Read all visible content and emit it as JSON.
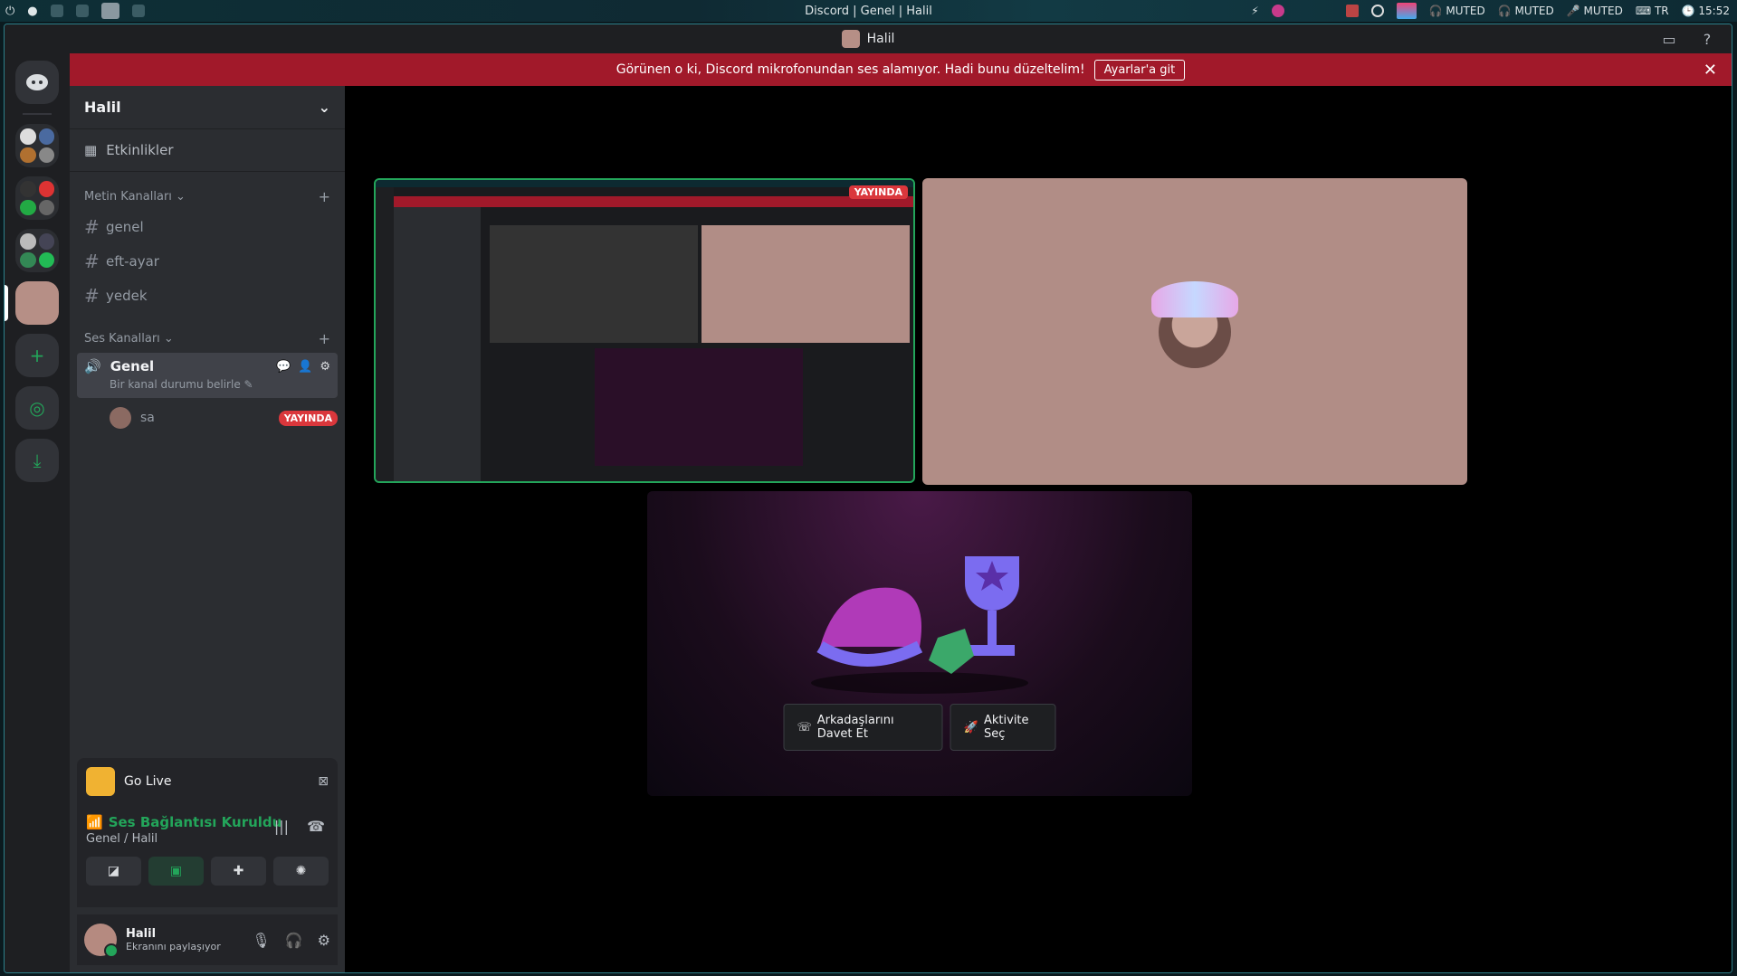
{
  "system_bar": {
    "title": "Discord | Genel | Halil",
    "tray": [
      "MUTED",
      "MUTED",
      "MUTED"
    ],
    "lang": "TR",
    "time": "15:52"
  },
  "window": {
    "title": "Halil"
  },
  "notice": {
    "text": "Görünen o ki, Discord mikrofonundan ses alamıyor. Hadi bunu düzeltelim!",
    "button": "Ayarlar'a git"
  },
  "sidebar": {
    "guild_name": "Halil",
    "events_label": "Etkinlikler",
    "text_category": "Metin Kanalları",
    "text_channels": [
      "genel",
      "eft-ayar",
      "yedek"
    ],
    "voice_category": "Ses Kanalları",
    "voice_channel": {
      "name": "Genel",
      "status_placeholder": "Bir kanal durumu belirle",
      "member_name": "sa",
      "member_badge": "YAYINDA"
    }
  },
  "bottom": {
    "golive_label": "Go Live",
    "voice_status": "Ses Bağlantısı Kuruldu",
    "voice_location": "Genel / Halil",
    "user_name": "Halil",
    "user_status": "Ekranını paylaşıyor"
  },
  "stage": {
    "screen_badge": "YAYINDA",
    "invite_button": "Arkadaşlarını Davet Et",
    "activity_button": "Aktivite Seç"
  }
}
